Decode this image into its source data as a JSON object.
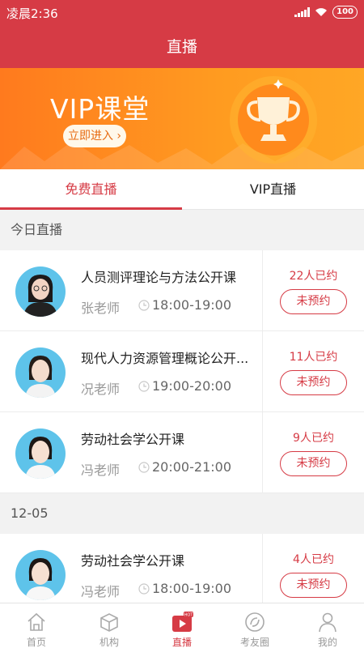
{
  "status_bar": {
    "time": "凌晨2:36",
    "battery": "100"
  },
  "nav": {
    "title": "直播"
  },
  "banner": {
    "title": "VIP课堂",
    "button": "立即进入 ›"
  },
  "tabs": [
    {
      "label": "免费直播",
      "active": true
    },
    {
      "label": "VIP直播",
      "active": false
    }
  ],
  "sections": [
    {
      "title": "今日直播"
    },
    {
      "title": "12-05"
    }
  ],
  "courses": [
    {
      "title": "人员测评理论与方法公开课",
      "teacher": "张老师",
      "time": "18:00-19:00",
      "count": "22人已约",
      "button": "未预约"
    },
    {
      "title": "现代人力资源管理概论公开...",
      "teacher": "况老师",
      "time": "19:00-20:00",
      "count": "11人已约",
      "button": "未预约"
    },
    {
      "title": "劳动社会学公开课",
      "teacher": "冯老师",
      "time": "20:00-21:00",
      "count": "9人已约",
      "button": "未预约"
    },
    {
      "title": "劳动社会学公开课",
      "teacher": "冯老师",
      "time": "18:00-19:00",
      "count": "4人已约",
      "button": "未预约"
    }
  ],
  "bottom_nav": [
    {
      "label": "首页",
      "icon": "home-icon",
      "active": false
    },
    {
      "label": "机构",
      "icon": "box-icon",
      "active": false
    },
    {
      "label": "直播",
      "icon": "live-play-icon",
      "active": true
    },
    {
      "label": "考友圈",
      "icon": "moments-icon",
      "active": false
    },
    {
      "label": "我的",
      "icon": "profile-icon",
      "active": false
    }
  ],
  "colors": {
    "brand": "#d63b45",
    "banner": "#ff9b20",
    "avatar_bg": "#5ec3ea"
  }
}
